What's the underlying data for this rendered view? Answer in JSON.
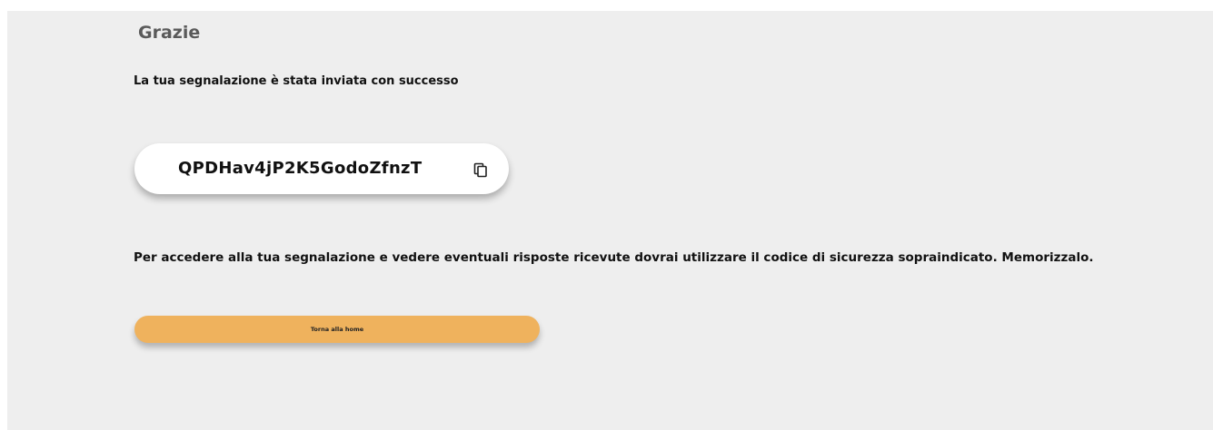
{
  "page": {
    "title": "Grazie",
    "success_message": "La tua segnalazione è stata inviata con successo",
    "security_code": "QPDHav4jP2K5GodoZfnzT",
    "info_message": "Per accedere alla tua segnalazione e vedere eventuali risposte ricevute dovrai utilizzare il codice di sicurezza sopraindicato. Memorizzalo.",
    "home_button_label": "Torna alla home"
  },
  "icons": {
    "copy": "copy-icon"
  },
  "colors": {
    "background": "#eeeeee",
    "title": "#5a5a5a",
    "text": "#111111",
    "code_box": "#ffffff",
    "home_button": "#efb25d"
  }
}
